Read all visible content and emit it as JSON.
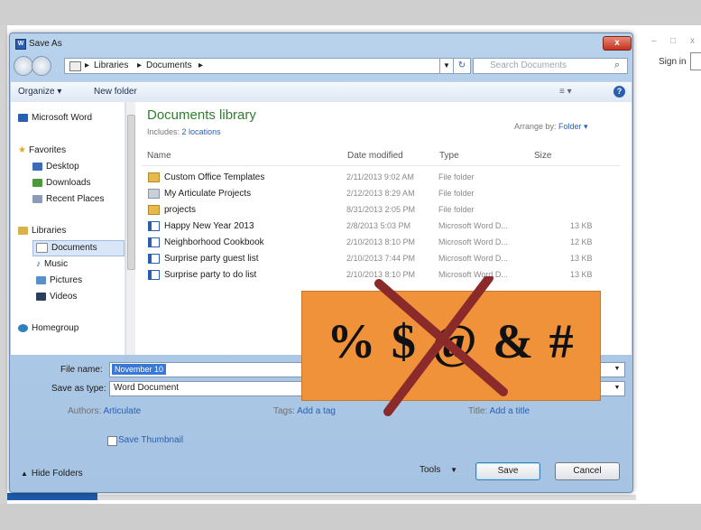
{
  "dialog": {
    "title": "Save As",
    "close": "x",
    "address": {
      "crumbs": [
        "Libraries",
        "Documents"
      ]
    },
    "search_placeholder": "Search Documents",
    "toolbar": {
      "organize": "Organize ▾",
      "new_folder": "New folder",
      "view": "≡ ▾",
      "help": "?"
    },
    "nav": {
      "top_item": "Microsoft Word",
      "favorites_header": "Favorites",
      "favorites": [
        "Desktop",
        "Downloads",
        "Recent Places"
      ],
      "libraries_header": "Libraries",
      "libraries": [
        "Documents",
        "Music",
        "Pictures",
        "Videos"
      ],
      "homegroup": "Homegroup"
    },
    "library": {
      "title": "Documents library",
      "includes_label": "Includes:",
      "includes_link": "2 locations",
      "arrange_label": "Arrange by:",
      "arrange_value": "Folder ▾"
    },
    "columns": {
      "name": "Name",
      "date": "Date modified",
      "type": "Type",
      "size": "Size"
    },
    "files": [
      {
        "name": "Custom Office Templates",
        "date": "2/11/2013 9:02 AM",
        "type": "File folder",
        "size": "",
        "kind": "folder"
      },
      {
        "name": "My Articulate Projects",
        "date": "2/12/2013 8:29 AM",
        "type": "File folder",
        "size": "",
        "kind": "folder2"
      },
      {
        "name": "projects",
        "date": "8/31/2013 2:05 PM",
        "type": "File folder",
        "size": "",
        "kind": "folder"
      },
      {
        "name": "Happy New Year 2013",
        "date": "2/8/2013 5:03 PM",
        "type": "Microsoft Word D...",
        "size": "13 KB",
        "kind": "doc"
      },
      {
        "name": "Neighborhood Cookbook",
        "date": "2/10/2013 8:10 PM",
        "type": "Microsoft Word D...",
        "size": "12 KB",
        "kind": "doc"
      },
      {
        "name": "Surprise party guest list",
        "date": "2/10/2013 7:44 PM",
        "type": "Microsoft Word D...",
        "size": "13 KB",
        "kind": "doc"
      },
      {
        "name": "Surprise party to do list",
        "date": "2/10/2013 8:10 PM",
        "type": "Microsoft Word D...",
        "size": "13 KB",
        "kind": "doc"
      }
    ],
    "form": {
      "file_name_label": "File name:",
      "file_name_value": "November 10",
      "save_type_label": "Save as type:",
      "save_type_value": "Word Document",
      "authors_label": "Authors:",
      "authors_value": "Articulate",
      "tags_label": "Tags:",
      "tags_value": "Add a tag",
      "title_label": "Title:",
      "title_value": "Add a title",
      "thumbnail_label": "Save Thumbnail"
    },
    "footer": {
      "hide_folders": "Hide Folders",
      "tools": "Tools",
      "save": "Save",
      "cancel": "Cancel"
    }
  },
  "background_window": {
    "controls": [
      "–",
      "□",
      "x"
    ],
    "sign_in": "Sign in"
  },
  "overlay": {
    "symbols": "% $ @ & #"
  },
  "colors": {
    "accent": "#2a5fb0",
    "library_title": "#2f7e2f",
    "badge": "#f0923a",
    "cross": "#8b2a2a",
    "selection": "#3a78d8"
  }
}
